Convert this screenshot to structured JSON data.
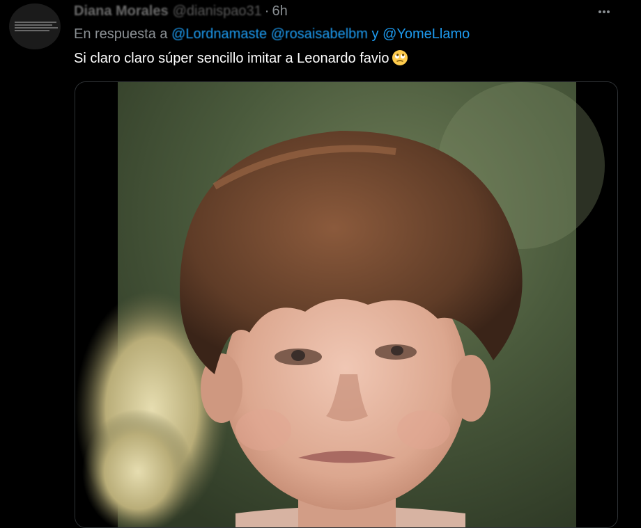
{
  "author": {
    "name": "Diana Morales",
    "handle": "@dianispao31",
    "separator": "·",
    "time": "6h"
  },
  "reply": {
    "prefix": "En respuesta a",
    "mentions": [
      "@Lordnamaste",
      "@rosaisabelbm"
    ],
    "conjunction": "y",
    "last_mention": "@YomeLlamo"
  },
  "tweet": {
    "text": "Si claro claro súper sencillo imitar a Leonardo favio",
    "emoji": "face-with-rolling-eyes"
  },
  "media": {
    "description_icon": "photo",
    "subject": "boy-portrait"
  },
  "colors": {
    "background": "#000000",
    "text": "#ffffff",
    "muted": "#8a8f93",
    "link": "#1d9bf0",
    "border": "#2f3336"
  }
}
